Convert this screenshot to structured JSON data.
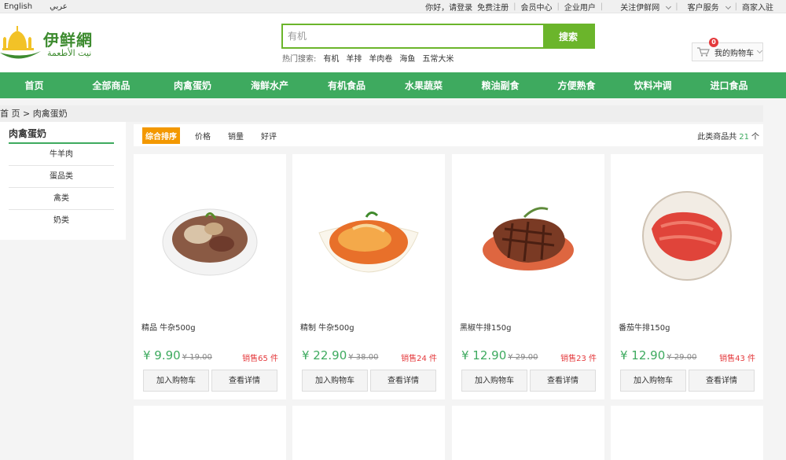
{
  "topbar": {
    "languages": [
      "English",
      "عربي"
    ],
    "greeting": "你好，请登录",
    "register": "免费注册",
    "member_center": "会员中心",
    "enterprise": "企业用户",
    "follow": "关注伊鲜网",
    "service": "客户服务",
    "merchant": "商家入驻"
  },
  "logo": {
    "cn": "伊鲜網",
    "ar": "نيت الأطعمة"
  },
  "search": {
    "placeholder": "有机",
    "button": "搜索",
    "hot_label": "热门搜索:",
    "hot_terms": [
      "有机",
      "羊排",
      "羊肉卷",
      "海鱼",
      "五常大米"
    ]
  },
  "cart": {
    "count": "0",
    "label": "我的购物车"
  },
  "nav": [
    "首页",
    "全部商品",
    "肉禽蛋奶",
    "海鲜水产",
    "有机食品",
    "水果蔬菜",
    "粮油副食",
    "方便熟食",
    "饮料冲调",
    "进口食品"
  ],
  "breadcrumb": "首 页 > 肉禽蛋奶",
  "sidebar": {
    "title": "肉禽蛋奶",
    "items": [
      "牛羊肉",
      "蛋品类",
      "禽类",
      "奶类"
    ]
  },
  "sort": {
    "options": [
      "综合排序",
      "价格",
      "销量",
      "好评"
    ],
    "total_prefix": "此类商品共",
    "total_count": "21",
    "total_suffix": "个"
  },
  "products": [
    {
      "name": "精品 牛杂500g",
      "price": "¥ 9.90",
      "old_price": "¥ 19.00",
      "sold": "销售65 件",
      "add_label": "加入购物车",
      "detail_label": "查看详情"
    },
    {
      "name": "精制 牛杂500g",
      "price": "¥ 22.90",
      "old_price": "¥ 38.00",
      "sold": "销售24 件",
      "add_label": "加入购物车",
      "detail_label": "查看详情"
    },
    {
      "name": "黑椒牛排150g",
      "price": "¥ 12.90",
      "old_price": "¥ 29.00",
      "sold": "销售23 件",
      "add_label": "加入购物车",
      "detail_label": "查看详情"
    },
    {
      "name": "番茄牛排150g",
      "price": "¥ 12.90",
      "old_price": "¥ 29.00",
      "sold": "销售43 件",
      "add_label": "加入购物车",
      "detail_label": "查看详情"
    }
  ],
  "colors": {
    "brand_green": "#3eaa5f",
    "search_green": "#6bb52b",
    "sale_red": "#e4393c",
    "sort_orange": "#f39800"
  }
}
